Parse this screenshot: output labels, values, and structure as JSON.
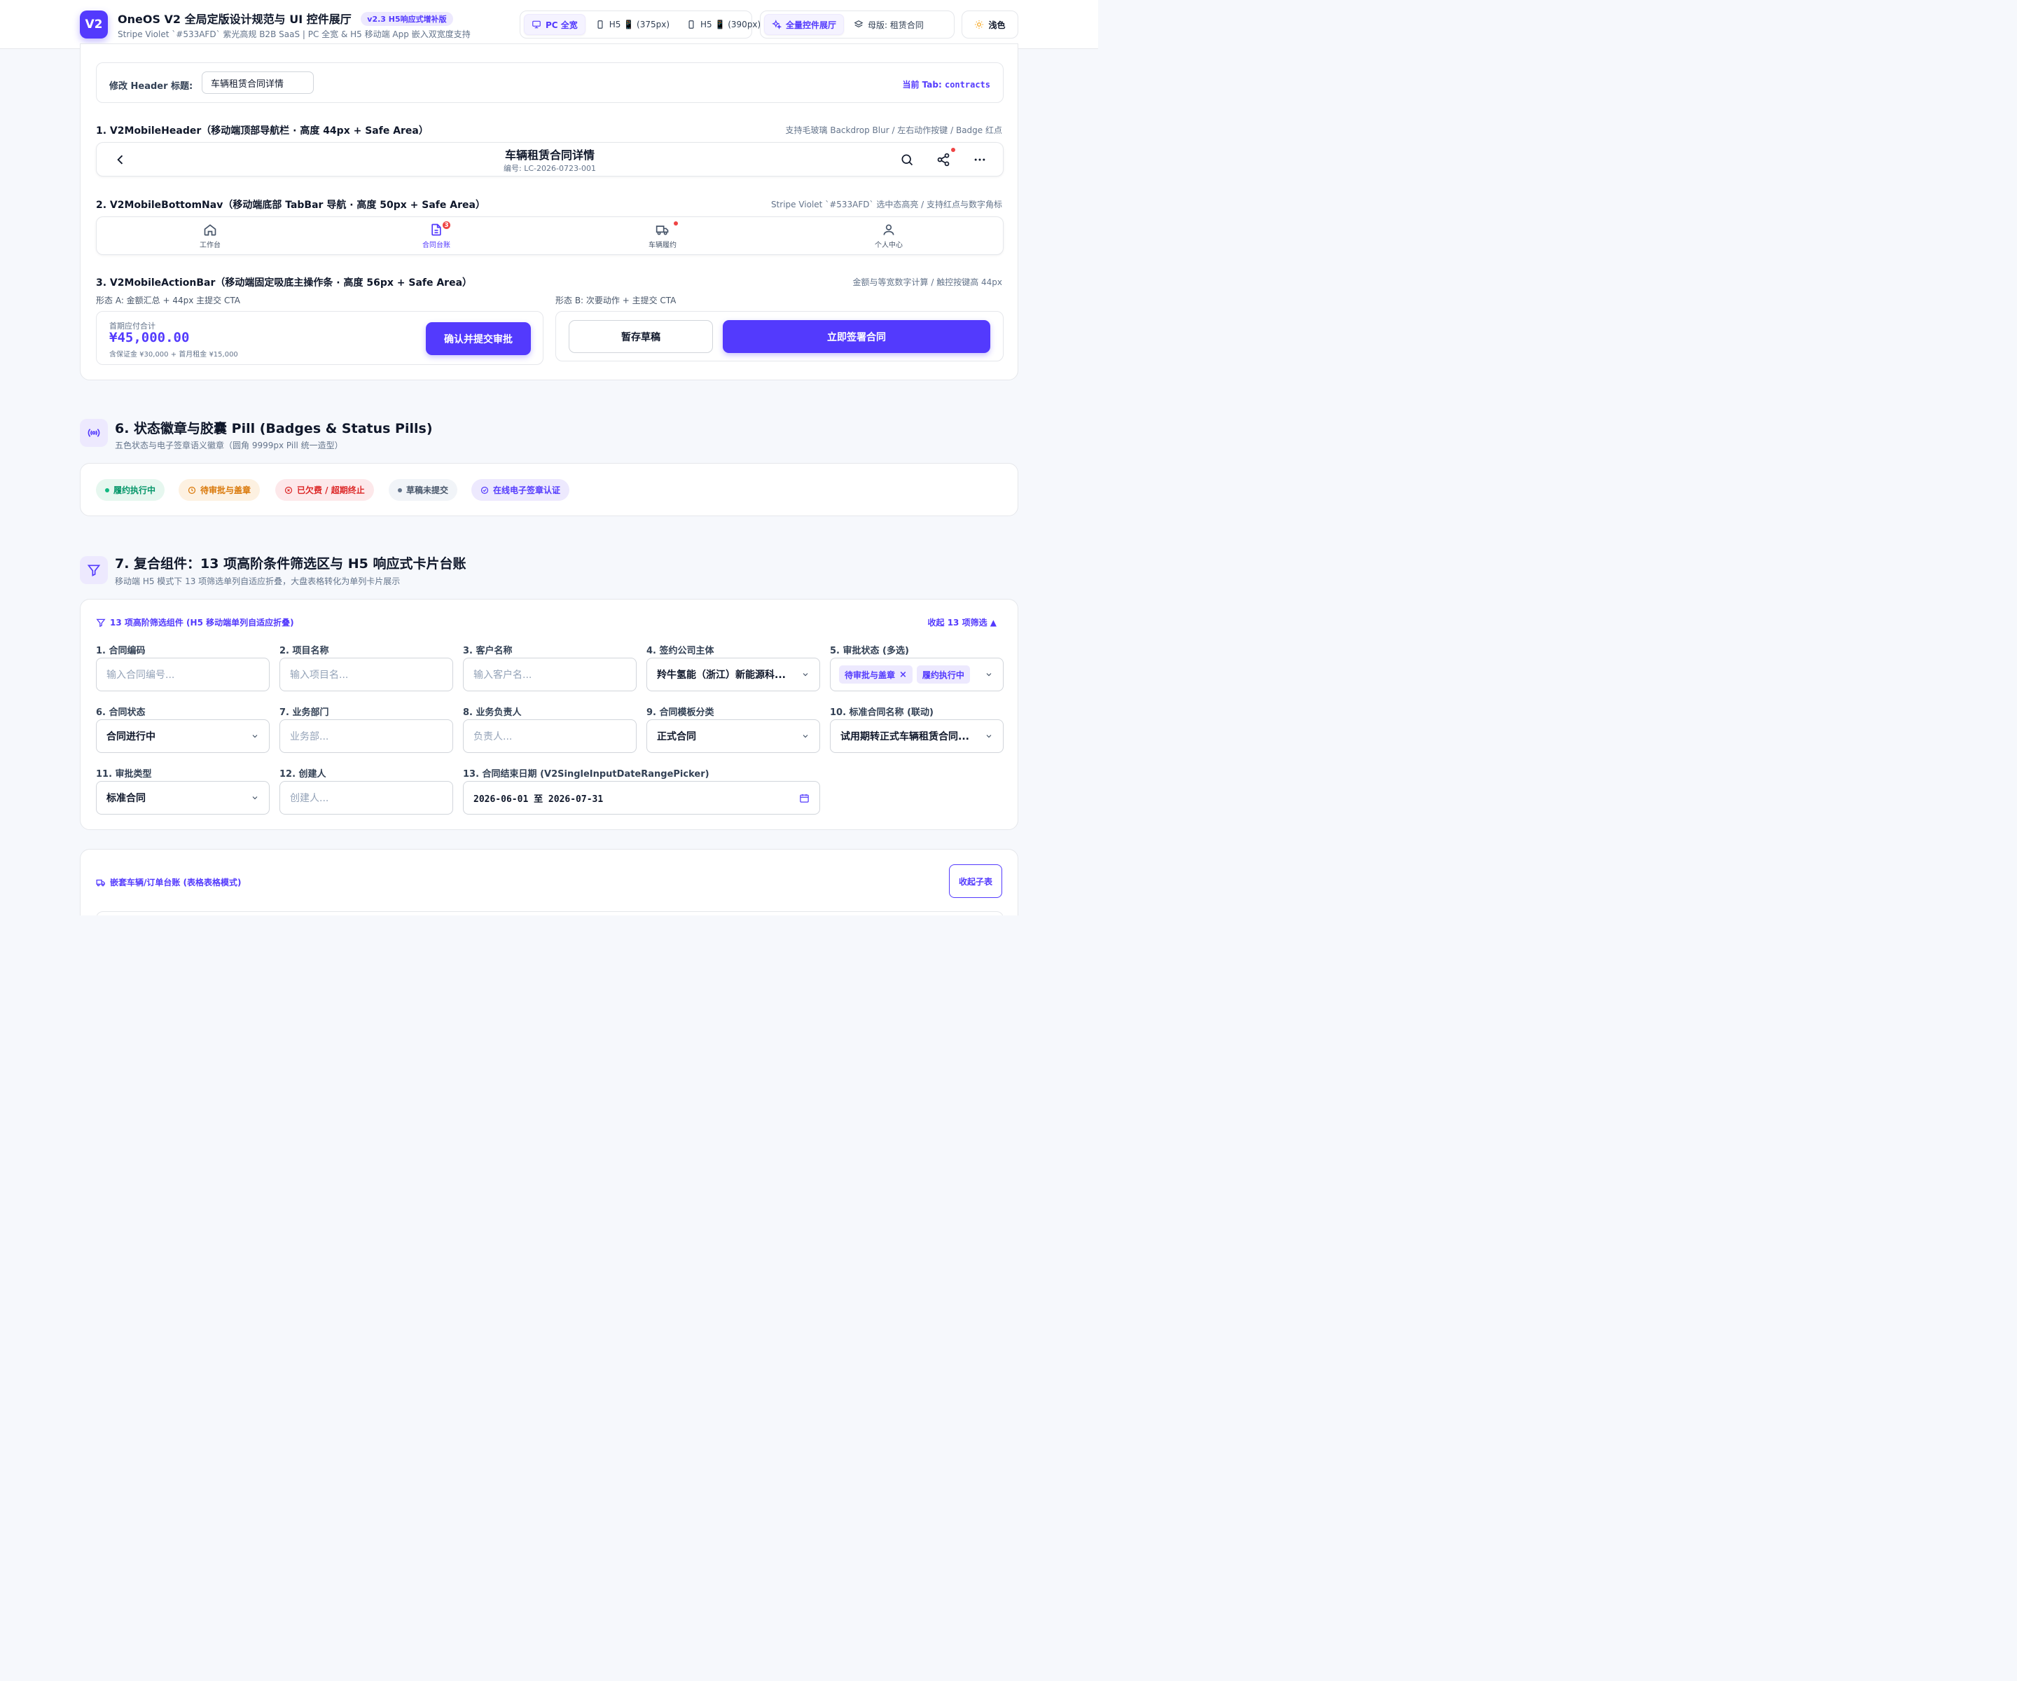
{
  "app": {
    "logo": "V2",
    "title": "OneOS V2 全局定版设计规范与 UI 控件展厅",
    "version_badge": "v2.3 H5响应式增补版",
    "subtitle": "Stripe Violet `#533AFD` 紫光高规 B2B SaaS | PC 全宽 & H5 移动端 App 嵌入双宽度支持"
  },
  "viewport_switch": {
    "items": [
      {
        "label": "PC 全宽",
        "icon": "monitor-icon",
        "active": true
      },
      {
        "label": "H5 📱 (375px)",
        "icon": "phone-icon",
        "active": false
      },
      {
        "label": "H5 📱 (390px)",
        "icon": "phone-icon",
        "active": false
      }
    ]
  },
  "view_switch": {
    "items": [
      {
        "label": "全量控件展厅",
        "icon": "sparkles-icon",
        "active": true
      },
      {
        "label": "母版: 租赁合同",
        "icon": "layers-icon",
        "active": false
      }
    ]
  },
  "theme_toggle": {
    "label": "浅色",
    "icon": "sun-icon"
  },
  "header_editor": {
    "label": "修改 Header 标题:",
    "value": "车辆租赁合同详情",
    "current_tab_label": "当前 Tab:",
    "current_tab_value": "contracts"
  },
  "mobile_header": {
    "heading": "1. V2MobileHeader（移动端顶部导航栏 · 高度 44px + Safe Area）",
    "note": "支持毛玻璃 Backdrop Blur / 左右动作按键 / Badge 红点",
    "title": "车辆租赁合同详情",
    "subtitle": "编号: LC-2026-0723-001"
  },
  "bottom_nav": {
    "heading": "2. V2MobileBottomNav（移动端底部 TabBar 导航 · 高度 50px + Safe Area）",
    "note": "Stripe Violet `#533AFD` 选中态高亮 / 支持红点与数字角标",
    "items": [
      {
        "label": "工作台",
        "icon": "home-icon"
      },
      {
        "label": "合同台账",
        "icon": "file-text-icon",
        "badge": "3"
      },
      {
        "label": "车辆履约",
        "icon": "truck-icon"
      },
      {
        "label": "个人中心",
        "icon": "user-icon"
      }
    ]
  },
  "action_bar": {
    "heading": "3. V2MobileActionBar（移动端固定吸底主操作条 · 高度 56px + Safe Area）",
    "note": "金额与等宽数字计算 / 触控按键高 44px",
    "form_a_label": "形态 A: 金额汇总 + 44px 主提交 CTA",
    "form_b_label": "形态 B: 次要动作 + 主提交 CTA",
    "amount_label": "首期应付合计",
    "amount": "¥45,000.00",
    "amount_note": "含保证金 ¥30,000 + 首月租金 ¥15,000",
    "submit_label": "确认并提交审批",
    "draft_label": "暂存草稿",
    "sign_label": "立即签署合同"
  },
  "section6": {
    "title": "6. 状态徽章与胶囊 Pill (Badges & Status Pills)",
    "subtitle": "五色状态与电子签章语义徽章（圆角 9999px Pill 统一造型）",
    "pills": [
      {
        "label": "履约执行中",
        "bg": "#e6f7ef",
        "fg": "#059669"
      },
      {
        "label": "待审批与盖章",
        "bg": "#fdf1e1",
        "fg": "#d97706"
      },
      {
        "label": "已欠费 / 超期终止",
        "bg": "#fde8ea",
        "fg": "#dc2626"
      },
      {
        "label": "草稿未提交",
        "bg": "#f1f4f8",
        "fg": "#475569"
      },
      {
        "label": "在线电子签章认证",
        "bg": "#ede9fe",
        "fg": "#533afd"
      }
    ]
  },
  "section7": {
    "title": "7. 复合组件：13 项高阶条件筛选区与 H5 响应式卡片台账",
    "subtitle": "移动端 H5 模式下 13 项筛选单列自适应折叠，大盘表格转化为单列卡片展示"
  },
  "filter": {
    "heading": "13 项高阶筛选组件 (H5 移动端单列自适应折叠)",
    "collapse": "收起 13 项筛选 ▲",
    "fields": [
      {
        "label": "1. 合同编码",
        "placeholder": "输入合同编号..."
      },
      {
        "label": "2. 项目名称",
        "placeholder": "输入项目名..."
      },
      {
        "label": "3. 客户名称",
        "placeholder": "输入客户名..."
      },
      {
        "label": "4. 签约公司主体",
        "value": "羚牛氢能（浙江）新能源科..."
      },
      {
        "label": "5. 审批状态 (多选)",
        "tags": [
          "待审批与盖章",
          "履约执行中"
        ]
      },
      {
        "label": "6. 合同状态",
        "value": "合同进行中"
      },
      {
        "label": "7. 业务部门",
        "placeholder": "业务部..."
      },
      {
        "label": "8. 业务负责人",
        "placeholder": "负责人..."
      },
      {
        "label": "9. 合同模板分类",
        "value": "正式合同"
      },
      {
        "label": "10. 标准合同名称 (联动)",
        "value": "试用期转正式车辆租赁合同..."
      },
      {
        "label": "11. 审批类型",
        "value": "标准合同"
      },
      {
        "label": "12. 创建人",
        "placeholder": "创建人..."
      },
      {
        "label": "13. 合同结束日期 (V2SingleInputDateRangePicker)",
        "value": "2026-06-01 至 2026-07-31"
      }
    ]
  },
  "subtable": {
    "heading": "嵌套车辆/订单台账 (表格表格模式)",
    "collapse_label": "收起子表"
  },
  "colors": {
    "accent": "#533AFD",
    "danger": "#EF4444"
  }
}
